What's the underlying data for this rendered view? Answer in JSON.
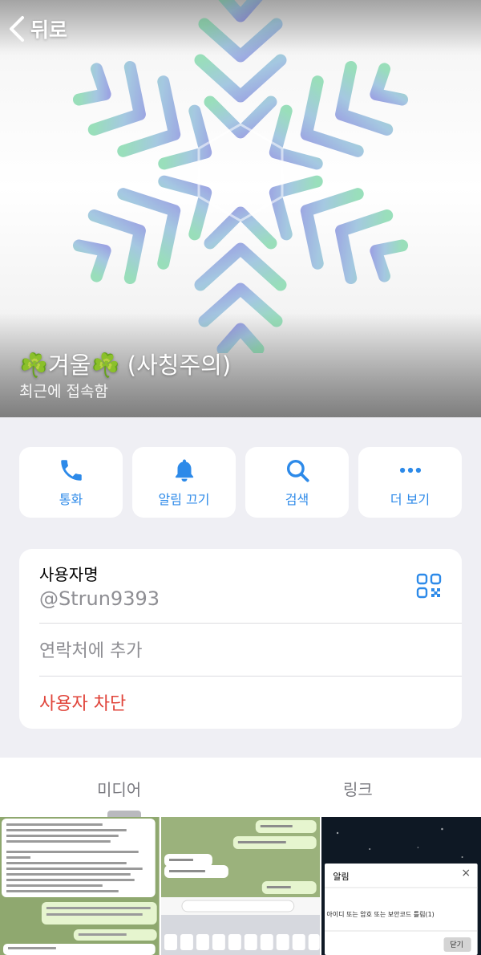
{
  "header": {
    "back_label": "뒤로",
    "profile_name": "☘️겨울☘️ (사칭주의)",
    "status": "최근에 접속함"
  },
  "actions": [
    {
      "label": "통화",
      "icon": "phone-icon"
    },
    {
      "label": "알림 끄기",
      "icon": "bell-icon"
    },
    {
      "label": "검색",
      "icon": "search-icon"
    },
    {
      "label": "더 보기",
      "icon": "more-icon"
    }
  ],
  "info": {
    "username_label": "사용자명",
    "username_value": "@Strun9393",
    "add_contact": "연락처에 추가",
    "block_user": "사용자 차단"
  },
  "tabs": {
    "media": "미디어",
    "links": "링크"
  },
  "media_thumbs": [
    {
      "kind": "chat-screenshot-1"
    },
    {
      "kind": "chat-screenshot-2"
    },
    {
      "kind": "alert-dialog",
      "title": "알림",
      "message": "아이디 또는 암호 또는 보안코드 틀림(1)",
      "button": "닫기"
    }
  ],
  "colors": {
    "accent": "#2d8ae9",
    "danger": "#e0443a",
    "secondary_text": "#8e8e93",
    "background": "#efeff4"
  }
}
